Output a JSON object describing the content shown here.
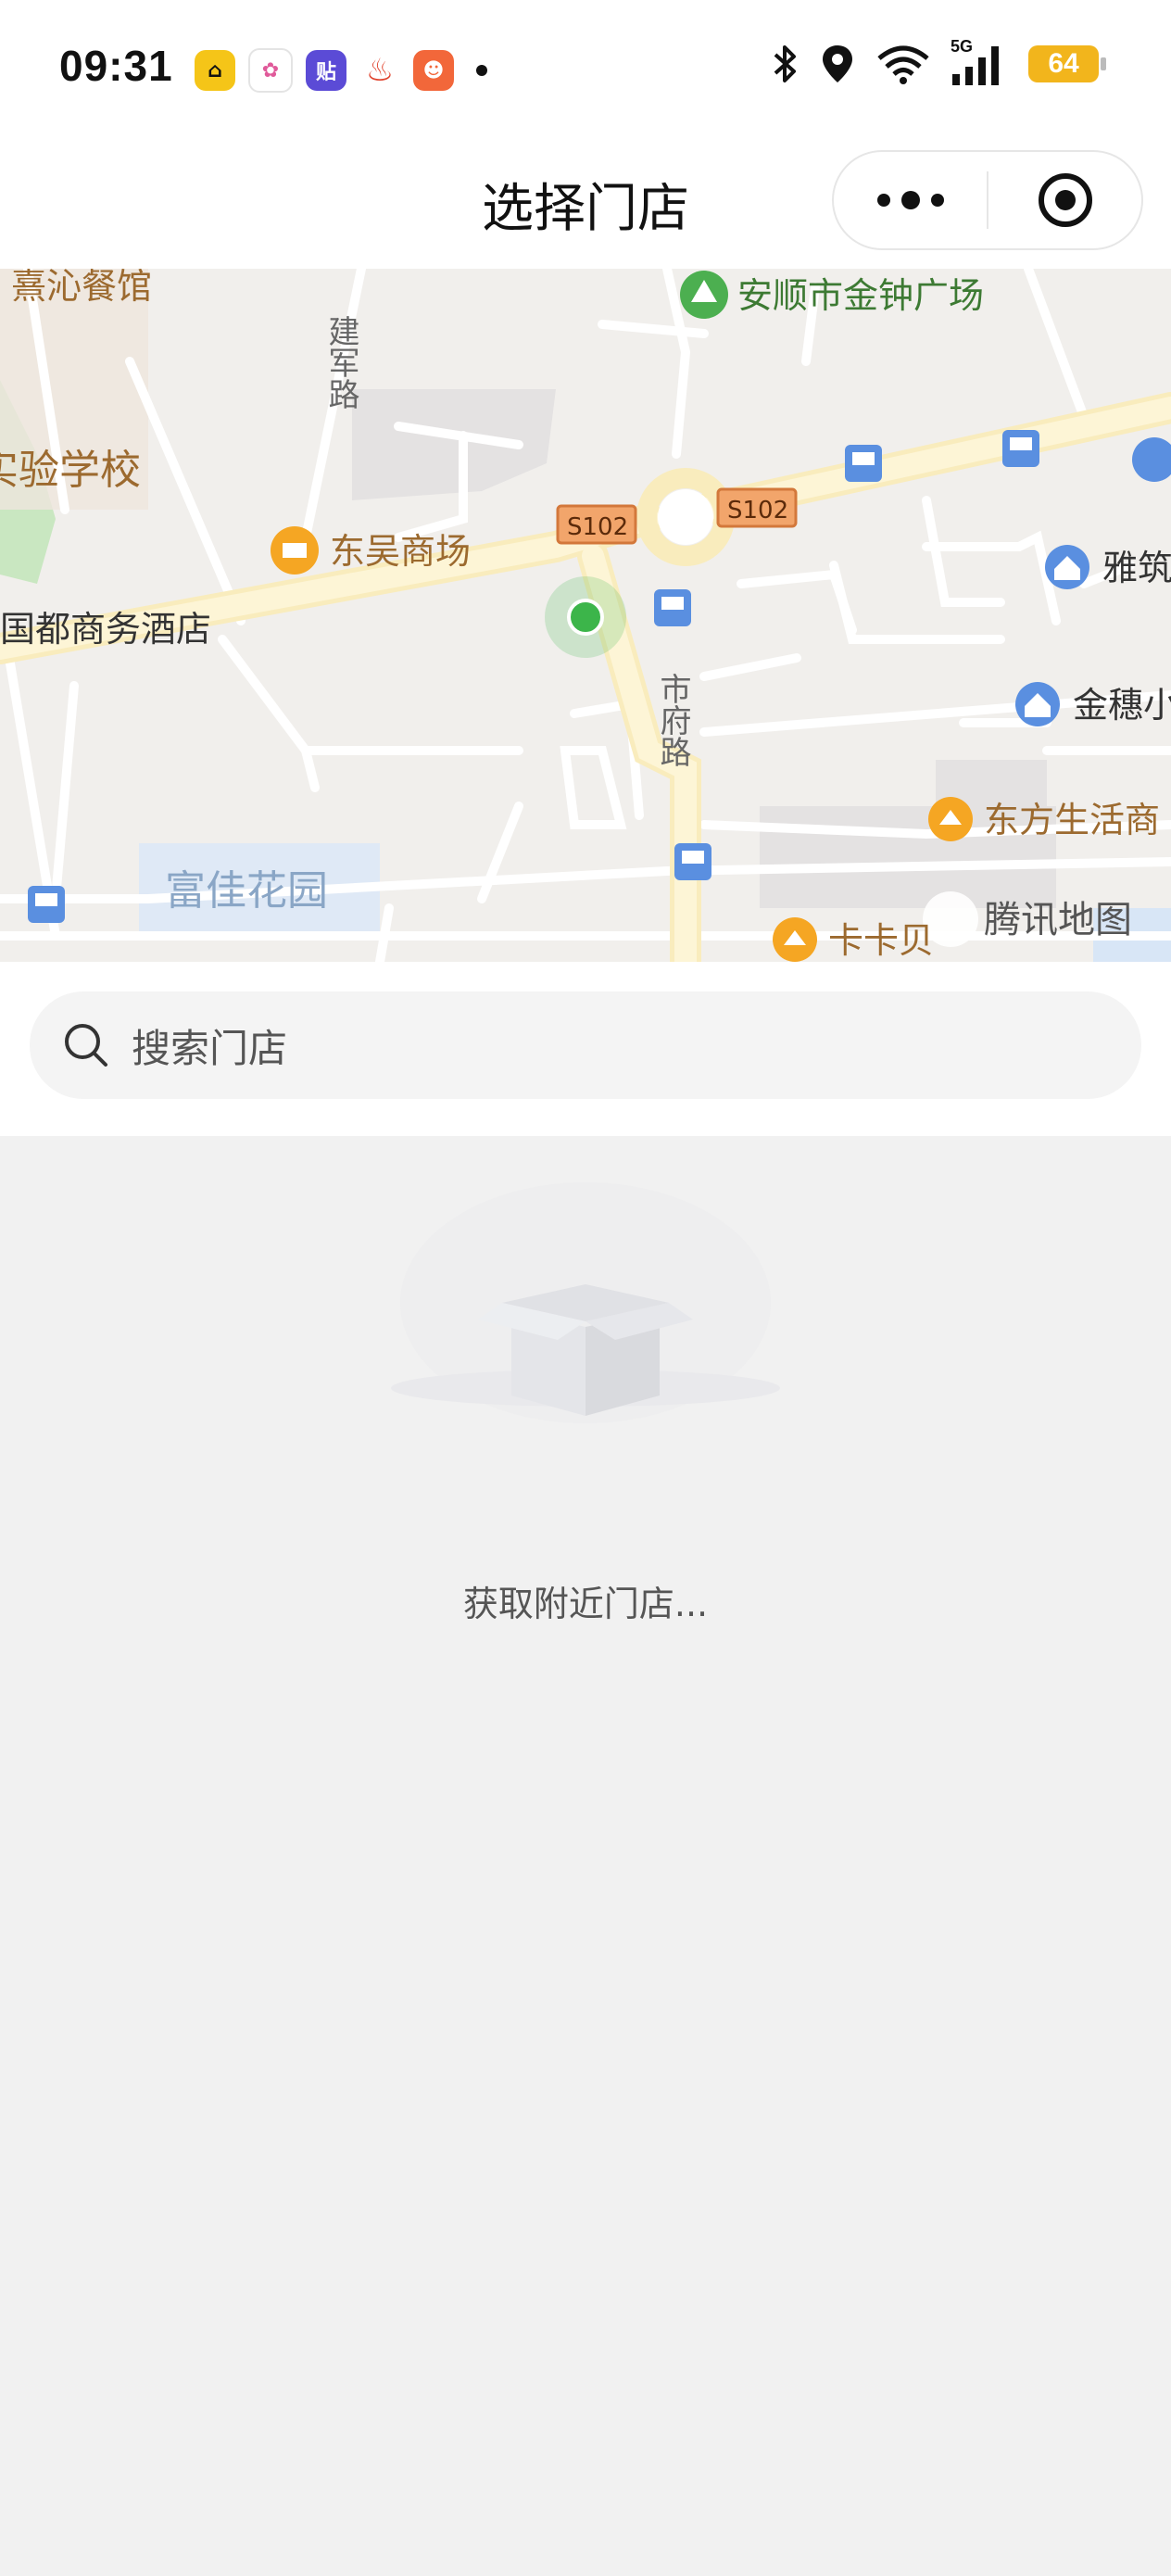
{
  "status_bar": {
    "time": "09:31",
    "battery": "64",
    "network": "5G",
    "icons": [
      "app-icon",
      "app-icon",
      "app-icon",
      "app-icon",
      "app-icon",
      "bluetooth-icon",
      "location-icon",
      "wifi-icon",
      "signal-icon",
      "battery-icon"
    ]
  },
  "nav": {
    "title": "选择门店",
    "more_icon": "more-dots-icon",
    "close_icon": "target-circle-icon"
  },
  "map": {
    "labels": {
      "l1": "熹沁餐馆",
      "l2": "安顺市金钟广场",
      "l3": "建军路",
      "l4": "实验学校",
      "l5": "S102",
      "l6": "S102",
      "l7": "东吴商场",
      "l8": "雅筑",
      "l9": "国都商务酒店",
      "l10": "市府路",
      "l11": "金穗小",
      "l12": "东方生活商",
      "l13": "富佳花园",
      "l14": "卡卡贝",
      "l15": "腾讯地图"
    }
  },
  "search": {
    "placeholder": "搜索门店",
    "icon": "search-icon"
  },
  "empty_state": {
    "message": "获取附近门店..."
  },
  "colors": {
    "map_bg": "#f1efec",
    "road": "#fdf5d6",
    "location_dot": "#3cb54a",
    "battery": "#f2b51c"
  }
}
